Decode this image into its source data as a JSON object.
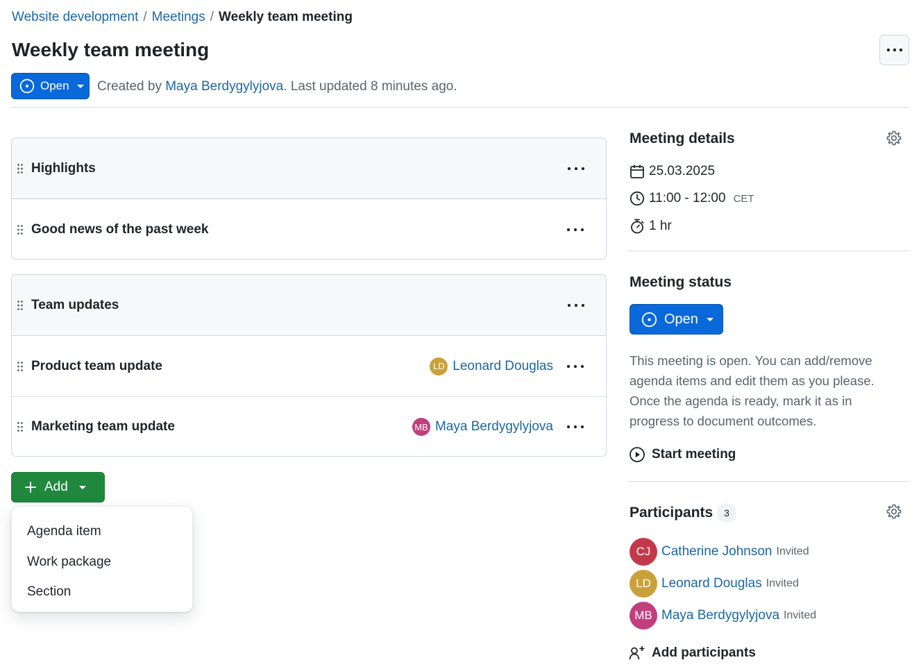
{
  "breadcrumb": {
    "project": "Website development",
    "module": "Meetings",
    "current": "Weekly team meeting",
    "separator": "/"
  },
  "page": {
    "title": "Weekly team meeting",
    "status_label": "Open",
    "created_prefix": "Created by ",
    "creator": "Maya Berdygylyjova",
    "updated_text": ". Last updated 8 minutes ago."
  },
  "agenda": {
    "sections": [
      {
        "title": "Highlights",
        "items": [
          {
            "title": "Good news of the past week",
            "presenter": null
          }
        ]
      },
      {
        "title": "Team updates",
        "items": [
          {
            "title": "Product team update",
            "presenter": {
              "name": "Leonard Douglas",
              "initials": "LD",
              "color": "#c9a13c"
            }
          },
          {
            "title": "Marketing team update",
            "presenter": {
              "name": "Maya Berdygylyjova",
              "initials": "MB",
              "color": "#c23f7e"
            }
          }
        ]
      }
    ]
  },
  "add_menu": {
    "button_label": "Add",
    "items": [
      "Agenda item",
      "Work package",
      "Section"
    ]
  },
  "details": {
    "title": "Meeting details",
    "date": "25.03.2025",
    "time": "11:00 - 12:00",
    "timezone": "CET",
    "duration": "1 hr"
  },
  "status": {
    "title": "Meeting status",
    "button_label": "Open",
    "description": "This meeting is open. You can add/remove agenda items and edit them as you please. Once the agenda is ready, mark it as in progress to document outcomes.",
    "start_label": "Start meeting"
  },
  "participants": {
    "title": "Participants",
    "count": "3",
    "list": [
      {
        "name": "Catherine Johnson",
        "initials": "CJ",
        "status": "Invited",
        "color": "#c2394c"
      },
      {
        "name": "Leonard Douglas",
        "initials": "LD",
        "status": "Invited",
        "color": "#c9a13c"
      },
      {
        "name": "Maya Berdygylyjova",
        "initials": "MB",
        "status": "Invited",
        "color": "#c23f7e"
      }
    ],
    "add_label": "Add participants"
  },
  "colors": {
    "primary": "#0969da",
    "success": "#1f883d",
    "link": "#1a67a3"
  }
}
